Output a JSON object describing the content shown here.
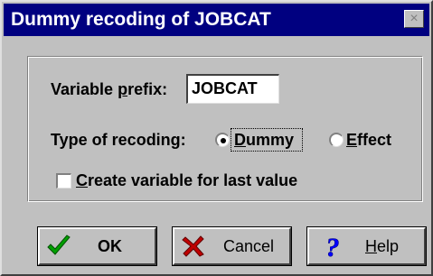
{
  "window": {
    "title": "Dummy recoding of JOBCAT",
    "close_glyph": "×"
  },
  "form": {
    "prefix_label_before": "Variable ",
    "prefix_label_mnemonic": "p",
    "prefix_label_after": "refix:",
    "prefix_value": "JOBCAT",
    "recoding_label": "Type of recoding:",
    "options": [
      {
        "mnemonic": "D",
        "rest": "ummy",
        "selected": true
      },
      {
        "mnemonic": "E",
        "rest": "ffect",
        "selected": false
      }
    ],
    "checkbox_mnemonic": "C",
    "checkbox_rest": "reate variable for last value",
    "checkbox_checked": false
  },
  "buttons": {
    "ok_label": "OK",
    "cancel_label": "Cancel",
    "help_mnemonic": "H",
    "help_rest": "elp"
  },
  "icons": {
    "ok": "checkmark-icon",
    "cancel": "x-icon",
    "help": "question-mark-icon"
  },
  "colors": {
    "titlebar": "#000080",
    "face": "#c0c0c0",
    "ok_check": "#00a000",
    "cancel_x": "#c00000",
    "help_q": "#0000ff"
  }
}
